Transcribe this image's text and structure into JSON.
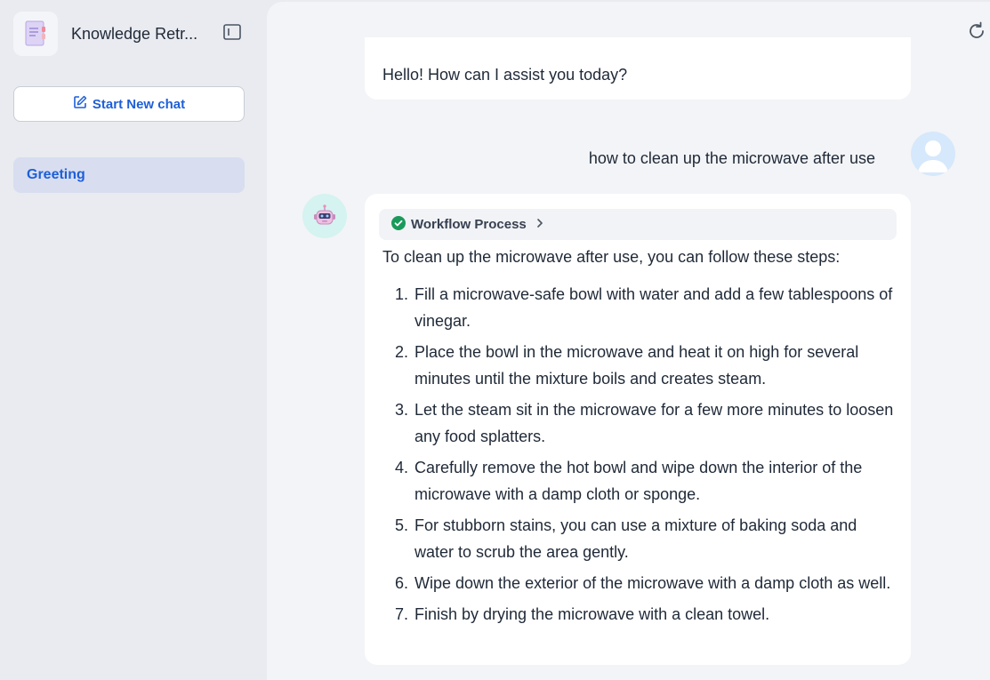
{
  "sidebar": {
    "app_title": "Knowledge Retr...",
    "new_chat_label": "Start New chat",
    "conversations": [
      {
        "label": "Greeting"
      }
    ]
  },
  "chat": {
    "greeting": "Hello! How can I assist you today?",
    "user_message": "how to clean up the microwave after use",
    "workflow_label": "Workflow Process",
    "answer_intro": "To clean up the microwave after use, you can follow these steps:",
    "steps": [
      "Fill a microwave-safe bowl with water and add a few tablespoons of vinegar.",
      "Place the bowl in the microwave and heat it on high for several minutes until the mixture boils and creates steam.",
      "Let the steam sit in the microwave for a few more minutes to loosen any food splatters.",
      "Carefully remove the hot bowl and wipe down the interior of the microwave with a damp cloth or sponge.",
      "For stubborn stains, you can use a mixture of baking soda and water to scrub the area gently.",
      "Wipe down the exterior of the microwave with a damp cloth as well.",
      "Finish by drying the microwave with a clean towel."
    ]
  },
  "icons": {
    "app": "notebook-icon",
    "collapse": "sidebar-toggle-icon",
    "new_chat": "edit-icon",
    "refresh": "refresh-icon",
    "workflow_status": "check-circle-icon",
    "workflow_expand": "chevron-right-icon"
  },
  "colors": {
    "accent": "#1e5fd8",
    "success": "#1a9a5a",
    "sidebar_bg": "#e9ebf0",
    "main_bg": "#f3f4f7"
  }
}
